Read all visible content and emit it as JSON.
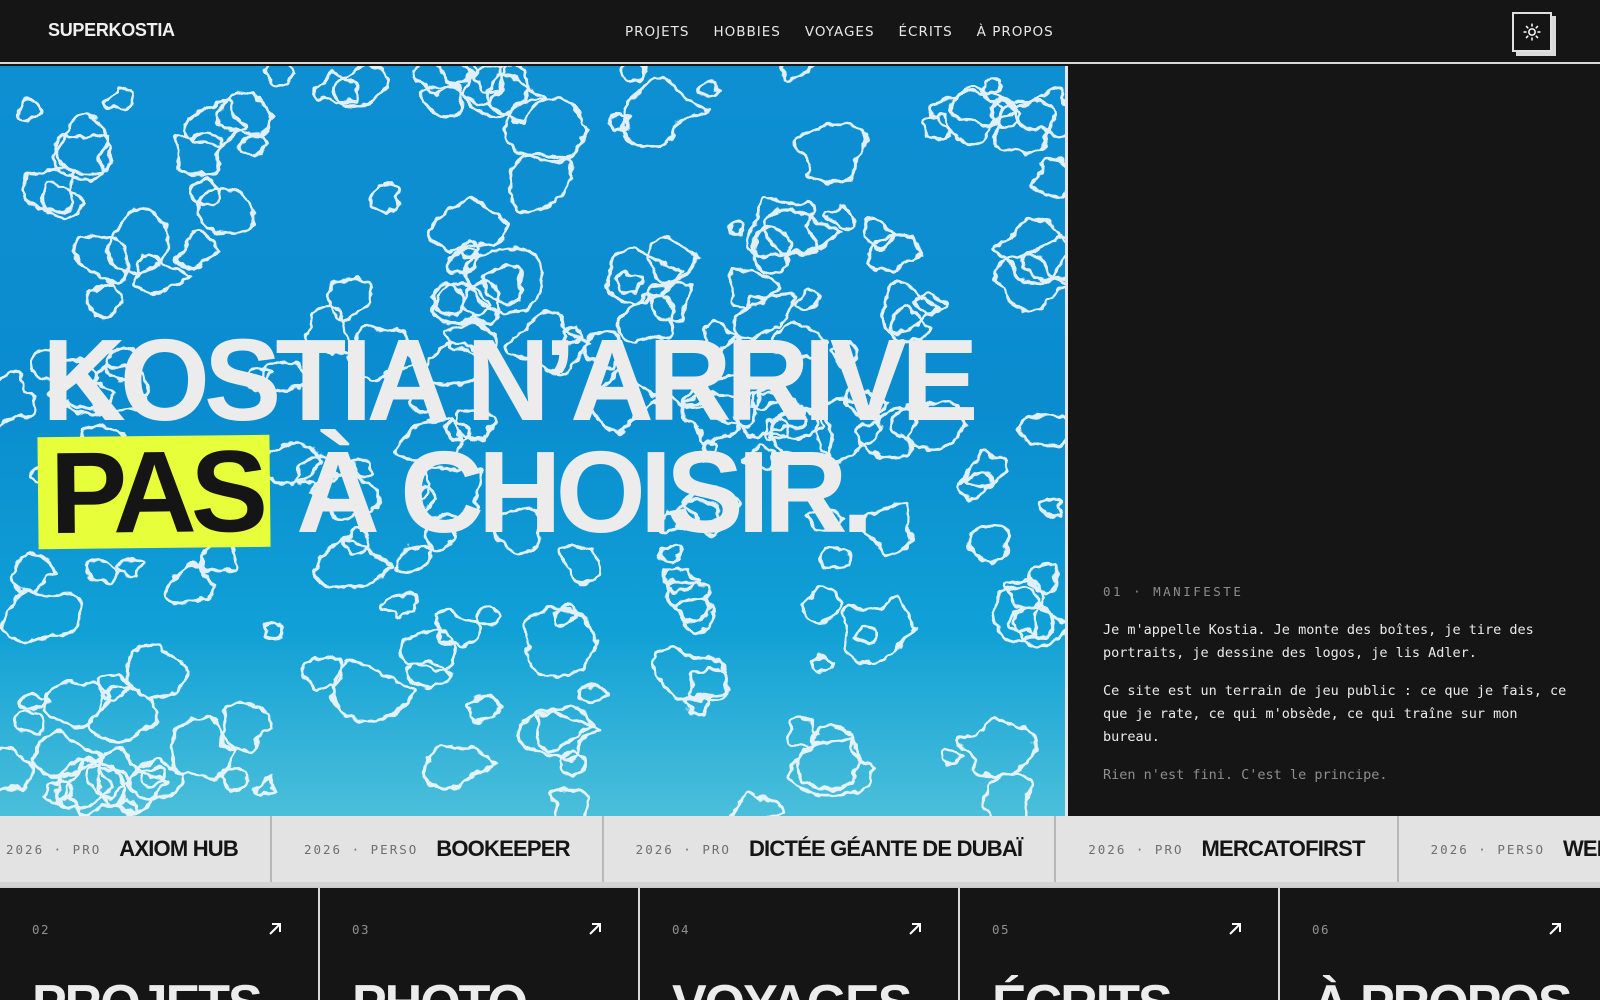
{
  "header": {
    "logo": "SUPERKOSTIA",
    "nav": [
      "PROJETS",
      "HOBBIES",
      "VOYAGES",
      "ÉCRITS",
      "À PROPOS"
    ],
    "theme_icon": "sun-icon"
  },
  "hero": {
    "line1": "KOSTIA N’ARRIVE",
    "highlight": "PAS",
    "line2_rest": "À CHOISIR.",
    "highlight_color": "#e6ff3a",
    "bg_color": "#0d8fd2"
  },
  "manifesto": {
    "label": "01 · MANIFESTE",
    "p1": "Je m'appelle Kostia. Je monte des boîtes, je tire des portraits, je dessine des logos, je lis Adler.",
    "p2": "Ce site est un terrain de jeu public : ce que je fais, ce que je rate, ce qui m'obsède, ce qui traîne sur mon bureau.",
    "p3": "Rien n'est fini. C'est le principe."
  },
  "ticker": [
    {
      "meta": "2026 · PRO",
      "title": "AXIOM HUB"
    },
    {
      "meta": "2026 · PERSO",
      "title": "BOOKEEPER"
    },
    {
      "meta": "2026 · PRO",
      "title": "DICTÉE GÉANTE DE DUBAÏ"
    },
    {
      "meta": "2026 · PRO",
      "title": "MERCATOFIRST"
    },
    {
      "meta": "2026 · PERSO",
      "title": "WED"
    }
  ],
  "cards": [
    {
      "num": "02",
      "title": "PROJETS"
    },
    {
      "num": "03",
      "title": "PHOTO"
    },
    {
      "num": "04",
      "title": "VOYAGES"
    },
    {
      "num": "05",
      "title": "ÉCRITS"
    },
    {
      "num": "06",
      "title": "À PROPOS"
    }
  ],
  "colors": {
    "background": "#151515",
    "text": "#eaeaea",
    "ticker_bg": "#e3e3e3"
  }
}
